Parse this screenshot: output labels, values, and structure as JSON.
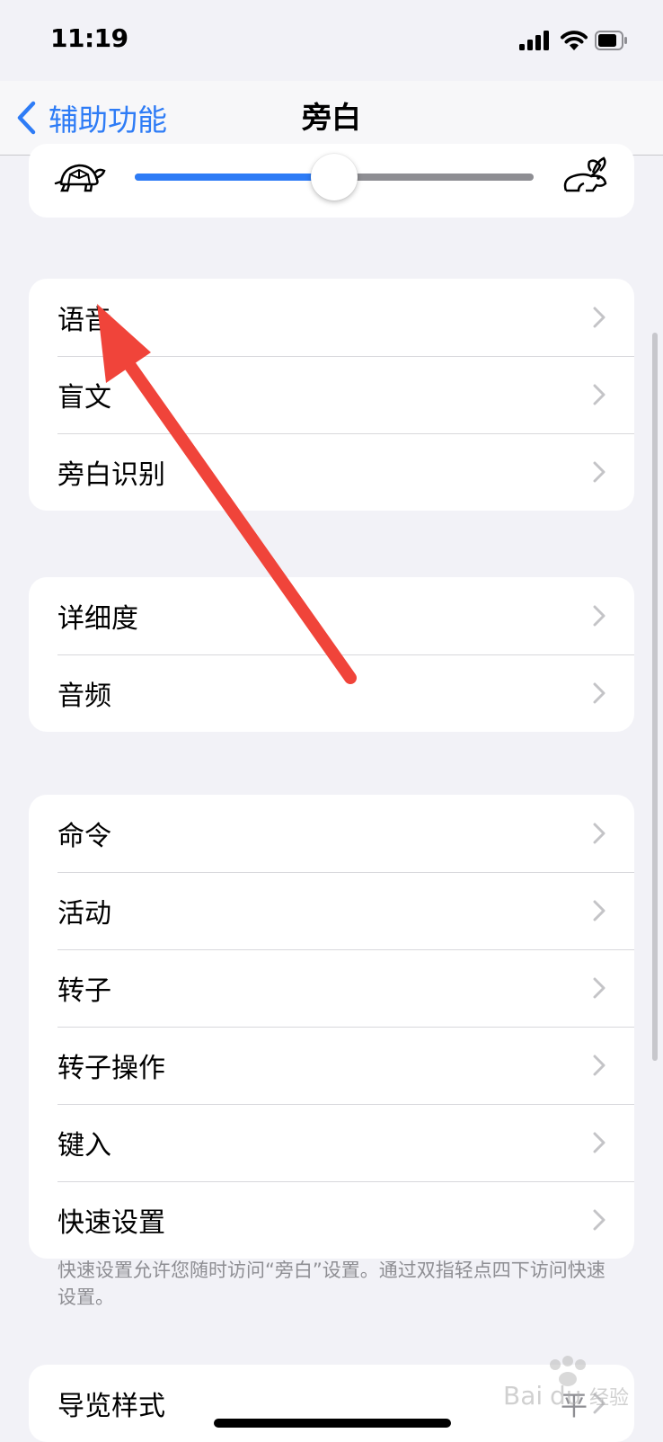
{
  "status_bar": {
    "time": "11:19"
  },
  "nav": {
    "back_label": "辅助功能",
    "title": "旁白"
  },
  "speaking_rate": {
    "value": 0.5
  },
  "group1": [
    {
      "label": "语音"
    },
    {
      "label": "盲文"
    },
    {
      "label": "旁白识别"
    }
  ],
  "group2": [
    {
      "label": "详细度"
    },
    {
      "label": "音频"
    }
  ],
  "group3": [
    {
      "label": "命令"
    },
    {
      "label": "活动"
    },
    {
      "label": "转子"
    },
    {
      "label": "转子操作"
    },
    {
      "label": "键入"
    },
    {
      "label": "快速设置"
    }
  ],
  "quick_settings_footnote": "快速设置允许您随时访问“旁白”设置。通过双指轻点四下访问快速设置。",
  "group4": [
    {
      "label": "导览样式",
      "value": "平"
    }
  ],
  "watermark": "Baidu 经验",
  "colors": {
    "accent": "#2e7cf6",
    "annotation_arrow": "#f0443a",
    "background": "#f2f2f7"
  }
}
